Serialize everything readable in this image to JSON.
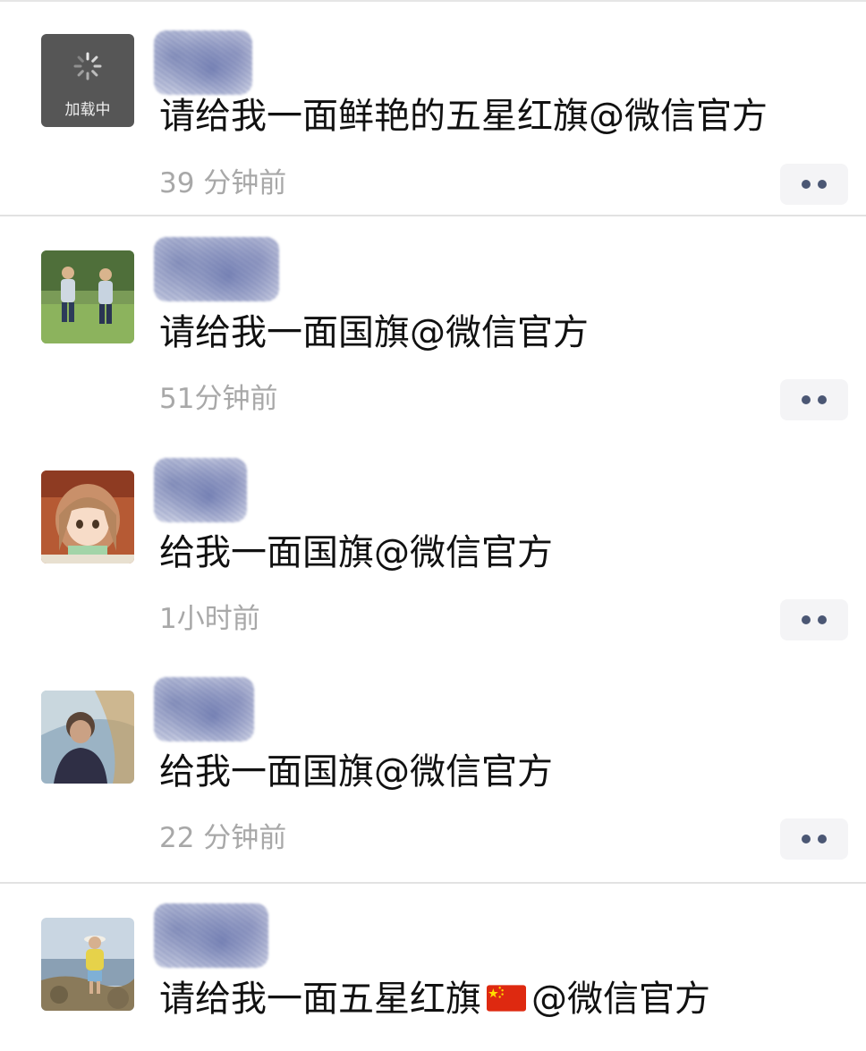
{
  "posts": [
    {
      "avatar_icon": "loading-spinner-icon",
      "avatar_label": "加载中",
      "text": "请给我一面鲜艳的五星红旗@微信官方",
      "time": "39 分钟前"
    },
    {
      "avatar_icon": "children-photo-avatar",
      "text": "请给我一面国旗@微信官方",
      "time": "51分钟前"
    },
    {
      "avatar_icon": "anime-girl-avatar",
      "text": "给我一面国旗@微信官方",
      "time": "1小时前"
    },
    {
      "avatar_icon": "boy-photo-avatar",
      "text": "给我一面国旗@微信官方",
      "time": "22 分钟前"
    },
    {
      "avatar_icon": "woman-beach-photo-avatar",
      "text_before_flag": "请给我一面五星红旗",
      "flag_icon": "china-flag-icon",
      "text_after_flag": "@微信官方"
    }
  ],
  "colors": {
    "time_gray": "#a8a8a8",
    "more_dots": "#4b5774",
    "flag_red": "#de2910",
    "flag_yellow": "#ffde00"
  }
}
